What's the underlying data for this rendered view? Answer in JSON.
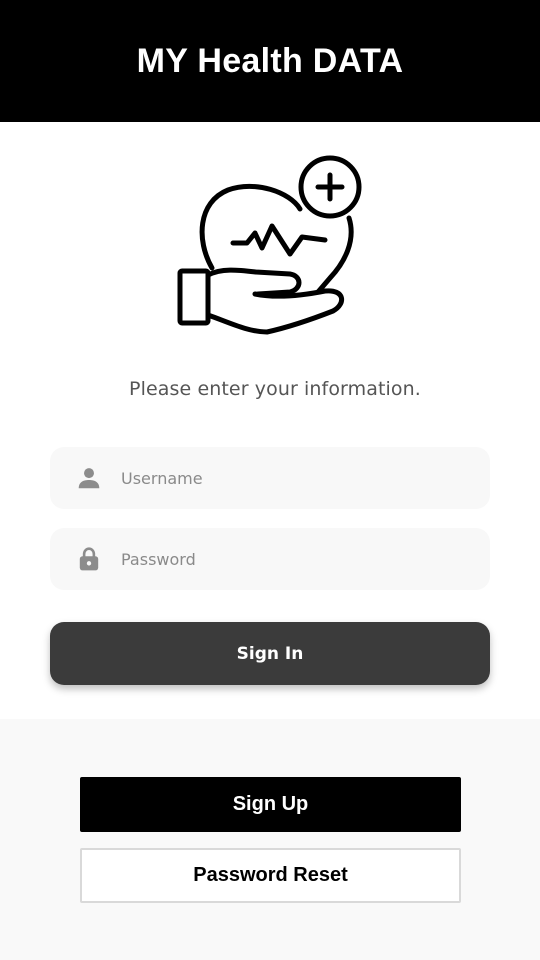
{
  "header": {
    "title": "MY Health DATA"
  },
  "hero": {
    "icon": "heart-in-hand-plus-icon"
  },
  "form": {
    "prompt": "Please enter your information.",
    "username": {
      "placeholder": "Username",
      "value": "",
      "icon": "user-icon"
    },
    "password": {
      "placeholder": "Password",
      "value": "",
      "icon": "lock-icon"
    },
    "sign_in_label": "Sign In"
  },
  "footer": {
    "sign_up_label": "Sign Up",
    "password_reset_label": "Password Reset"
  },
  "colors": {
    "header_bg": "#000000",
    "field_bg": "#f8f8f8",
    "signin_bg": "#3b3b3b",
    "icon_gray": "#8c8c8c",
    "bottom_panel_bg": "#f9f9f9"
  }
}
